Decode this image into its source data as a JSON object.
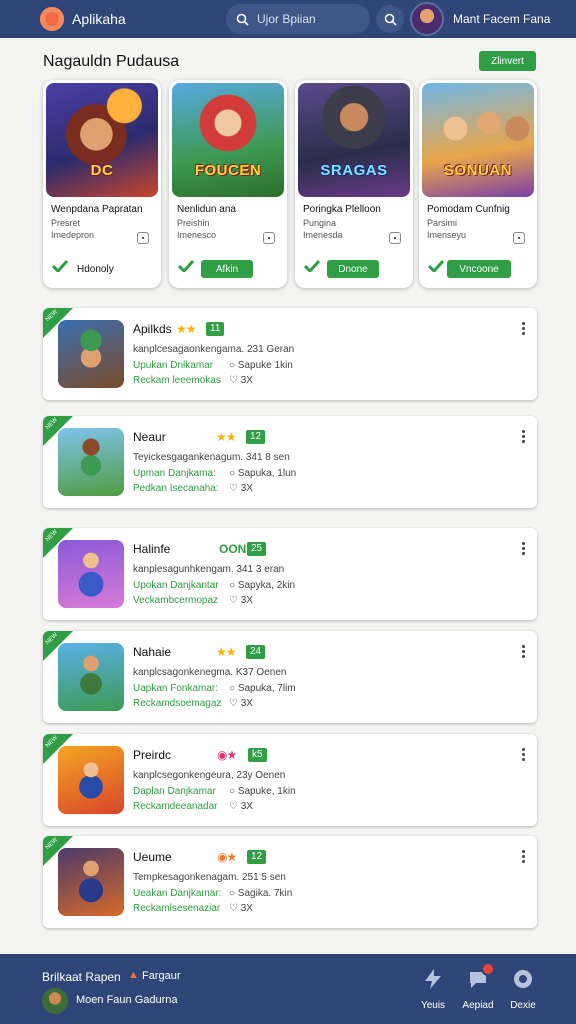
{
  "header": {
    "app_name": "Aplikaha",
    "search_placeholder": "Ujor Bpiian",
    "user_name": "Mant Facem Fana"
  },
  "featured": {
    "title": "Nagauldn Pudausa",
    "more_button": "Zlinvert",
    "cards": [
      {
        "art_text": "DC",
        "title": "Wenpdana Papratan",
        "sub1": "Presret",
        "sub2": "Imedepron",
        "action": "Hdonoly",
        "action_style": "plain"
      },
      {
        "art_text": "FOUCEN",
        "title": "Nenlidun ana",
        "sub1": "Preishin",
        "sub2": "Imenesco",
        "action": "Afkin",
        "action_style": "green"
      },
      {
        "art_text": "SRAGAS",
        "title": "Poringka Plelloon",
        "sub1": "Pungina",
        "sub2": "Imenesda",
        "action": "Dnone",
        "action_style": "green"
      },
      {
        "art_text": "SONUAN",
        "title": "Pomodam Cunfnig",
        "sub1": "Parsimi",
        "sub2": "Imenseyu",
        "action": "Vncoone",
        "action_style": "green"
      }
    ]
  },
  "apps": [
    {
      "name": "Apilkds",
      "rating_icon": "stars",
      "badge": "11",
      "desc": "kanplcesagaonkengama. 231 Geran",
      "green1": "Upukan Dnlkamar",
      "meta1": "Sapuke 1kin",
      "green2": "Reckam leeemokas",
      "meta2": "3X"
    },
    {
      "name": "Neaur",
      "rating_icon": "stars",
      "badge": "12",
      "desc": "Teyickesgagankenagum. 341 8 sen",
      "green1": "Upman Danjkama:",
      "meta1": "Sapuka, 1lun",
      "green2": "Pedkan Isecanaha:",
      "meta2": "3X"
    },
    {
      "name": "Halinfe",
      "rating_icon": "text",
      "rating_text": "OON",
      "badge": "25",
      "desc": "kanplesagunhkengam. 341 3 eran",
      "green1": "Upokan Danjkantar",
      "meta1": "Sapyka, 2kin",
      "green2": "Veckambcermopaz",
      "meta2": "3X"
    },
    {
      "name": "Nahaie",
      "rating_icon": "stars",
      "badge": "24",
      "desc": "kanplcsagonkenegma. K37 Oenen",
      "green1": "Uapkan Fonkamar:",
      "meta1": "Sapuka, 7lim",
      "green2": "Reckamdsoemagaz",
      "meta2": "3X"
    },
    {
      "name": "Preirdc",
      "rating_icon": "pink",
      "badge": "k5",
      "desc": "kanplcsegonkengeura, 23y Oenen",
      "green1": "Daplan Danjkamar",
      "meta1": "Sapuke, 1kin",
      "green2": "Reckamdeeanadar",
      "meta2": "3X"
    },
    {
      "name": "Ueume",
      "rating_icon": "orange",
      "badge": "12",
      "desc": "Tempkesagonkenagam. 251 5 sen",
      "green1": "Ueakan Danjkamar:",
      "meta1": "Sagika. 7kin",
      "green2": "Reckamlsesenaziar",
      "meta2": "3X"
    }
  ],
  "corner_tag": "NEW",
  "bottom": {
    "title": "Brilkaat Rapen",
    "tag": "Fargaur",
    "user_name": "Moen Faun Gadurna",
    "nav": [
      {
        "label": "Yeuis",
        "icon": "lightning-icon"
      },
      {
        "label": "Aepiad",
        "icon": "chat-icon"
      },
      {
        "label": "Dexie",
        "icon": "gamepad-icon"
      }
    ]
  },
  "colors": {
    "header_bg": "#2f4577",
    "accent_green": "#2f9e44",
    "star": "#f5b400"
  }
}
